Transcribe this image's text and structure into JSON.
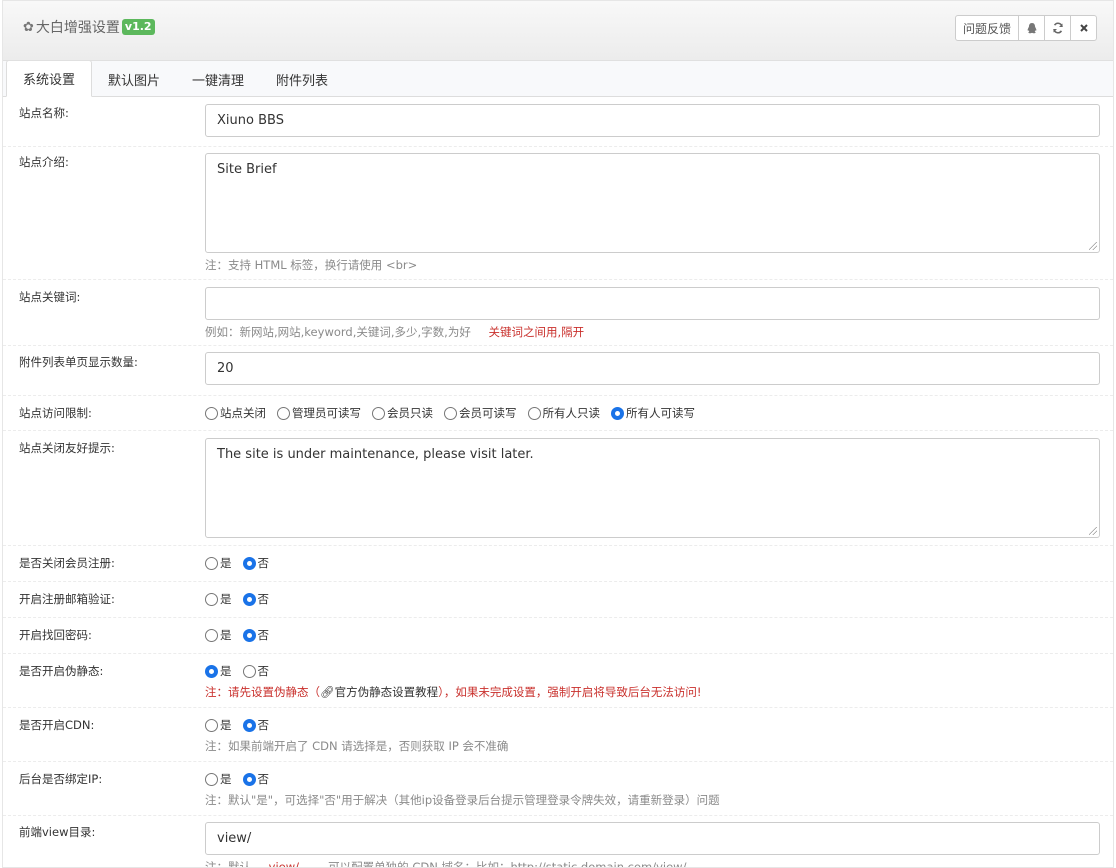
{
  "header": {
    "title": "大白增强设置",
    "version": "v1.2",
    "feedback_label": "问题反馈",
    "icons": [
      "gear-icon",
      "qq-icon",
      "refresh-icon",
      "close-icon"
    ]
  },
  "tabs": [
    {
      "label": "系统设置",
      "active": true
    },
    {
      "label": "默认图片",
      "active": false
    },
    {
      "label": "一键清理",
      "active": false
    },
    {
      "label": "附件列表",
      "active": false
    }
  ],
  "form": {
    "site_name": {
      "label": "站点名称:",
      "value": "Xiuno BBS"
    },
    "site_brief": {
      "label": "站点介绍:",
      "value": "Site Brief",
      "hint": "注：支持 HTML 标签，换行请使用 <br>"
    },
    "site_keywords": {
      "label": "站点关键词:",
      "value": "",
      "hint": "例如：新网站,网站,keyword,关键词,多少,字数,为好",
      "hint_red": "关键词之间用,隔开"
    },
    "attach_pagesize": {
      "label": "附件列表单页显示数量:",
      "value": "20"
    },
    "site_access": {
      "label": "站点访问限制:",
      "options": [
        "站点关闭",
        "管理员可读写",
        "会员只读",
        "会员可读写",
        "所有人只读",
        "所有人可读写"
      ],
      "selected": "所有人可读写"
    },
    "close_tip": {
      "label": "站点关闭友好提示:",
      "value": "The site is under maintenance, please visit later."
    },
    "close_register": {
      "label": "是否关闭会员注册:",
      "yes": "是",
      "no": "否",
      "selected": "否"
    },
    "email_verify": {
      "label": "开启注册邮箱验证:",
      "yes": "是",
      "no": "否",
      "selected": "否"
    },
    "find_password": {
      "label": "开启找回密码:",
      "yes": "是",
      "no": "否",
      "selected": "否"
    },
    "url_rewrite": {
      "label": "是否开启伪静态:",
      "yes": "是",
      "no": "否",
      "selected": "是",
      "warn_pre": "注：请先设置伪静态（",
      "warn_link": "官方伪静态设置教程",
      "warn_post": "），如果未完成设置，强制开启将导致后台无法访问!"
    },
    "cdn": {
      "label": "是否开启CDN:",
      "yes": "是",
      "no": "否",
      "selected": "否",
      "hint": "注：如果前端开启了 CDN 请选择是，否则获取 IP 会不准确"
    },
    "bind_ip": {
      "label": "后台是否绑定IP:",
      "yes": "是",
      "no": "否",
      "selected": "否",
      "hint": "注：默认\"是\"，可选择\"否\"用于解决（其他ip设备登录后台提示管理登录令牌失效，请重新登录）问题"
    },
    "view_dir": {
      "label": "前端view目录:",
      "value": "view/",
      "hint_pre": "注：默认",
      "hint_dir": "view/",
      "hint_post": "，可以配置单独的 CDN 域名：比如：http://static.domain.com/view/"
    }
  }
}
